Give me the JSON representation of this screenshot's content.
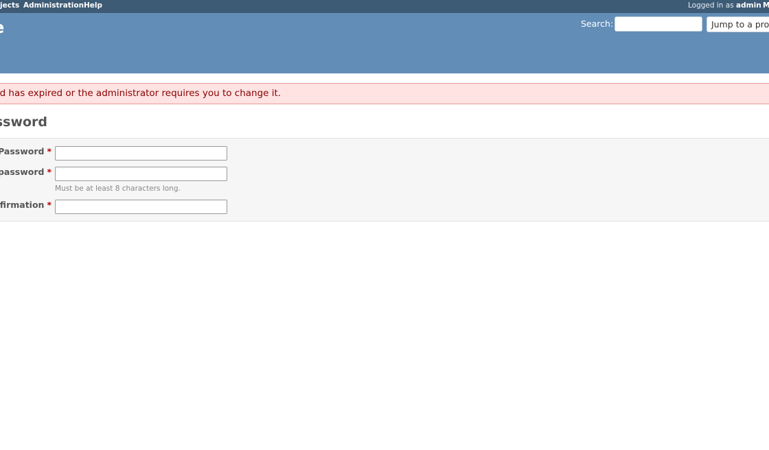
{
  "top_menu": {
    "items": [
      "jects",
      "Administration",
      "Help"
    ],
    "logged_in_prefix": "Logged in as",
    "logged_in_user": "admin",
    "my_account_fragment": "M"
  },
  "header": {
    "title_fragment": "e",
    "search_label": "Search:",
    "search_value": "",
    "jump_label": "Jump to a proj"
  },
  "flash": {
    "error": "ord has expired or the administrator requires you to change it."
  },
  "page": {
    "title": "assword"
  },
  "form": {
    "fields": [
      {
        "label": "Password",
        "required": "*",
        "value": ""
      },
      {
        "label": "password",
        "required": "*",
        "value": "",
        "hint": "Must be at least 8 characters long."
      },
      {
        "label": "nfirmation",
        "required": "*",
        "value": ""
      }
    ]
  },
  "colors": {
    "top_menu_bg": "#3e5b76",
    "header_bg": "#628db6",
    "flash_error_bg": "#ffe3e3",
    "flash_error_text": "#880000",
    "form_bg": "#f6f6f6",
    "required_marker": "#bb0000"
  }
}
